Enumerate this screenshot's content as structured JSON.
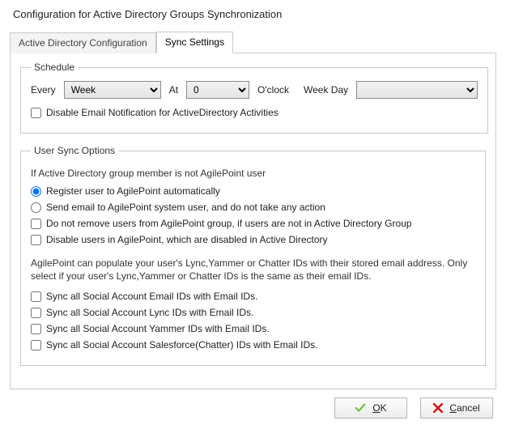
{
  "title": "Configuration for Active Directory Groups Synchronization",
  "tabs": {
    "config": "Active Directory Configuration",
    "sync": "Sync Settings"
  },
  "schedule": {
    "legend": "Schedule",
    "every_label": "Every",
    "every_value": "Week",
    "at_label": "At",
    "hour_value": "0",
    "oclock_label": "O'clock",
    "weekday_label": "Week Day",
    "weekday_value": "",
    "disable_email_label": "Disable Email Notification for ActiveDirectory Activities",
    "disable_email_checked": false
  },
  "user_sync": {
    "legend": "User Sync Options",
    "heading": "If Active Directory group member is not AgilePoint user",
    "radios": [
      {
        "label": "Register user to AgilePoint automatically",
        "checked": true
      },
      {
        "label": "Send email to AgilePoint system user, and do not take any action",
        "checked": false
      }
    ],
    "checks_top": [
      {
        "label": "Do not remove users from AgilePoint group, if users are not in Active Directory Group",
        "checked": false
      },
      {
        "label": "Disable users in AgilePoint, which are disabled in Active Directory",
        "checked": false
      }
    ],
    "note": "AgilePoint can populate your user's Lync,Yammer or Chatter IDs with their stored email address. Only select if your user's Lync,Yammer or Chatter IDs is the same as their email IDs.",
    "checks_social": [
      {
        "label": "Sync all Social Account Email IDs with Email IDs.",
        "checked": false
      },
      {
        "label": "Sync all Social Account Lync IDs with Email IDs.",
        "checked": false
      },
      {
        "label": "Sync all Social Account Yammer IDs with Email IDs.",
        "checked": false
      },
      {
        "label": "Sync all Social Account Salesforce(Chatter) IDs with Email IDs.",
        "checked": false
      }
    ]
  },
  "buttons": {
    "ok_prefix": "O",
    "ok_rest": "K",
    "cancel_prefix": "C",
    "cancel_rest": "ancel"
  },
  "colors": {
    "check_icon": "#6fbf3a",
    "x_icon": "#d11"
  }
}
